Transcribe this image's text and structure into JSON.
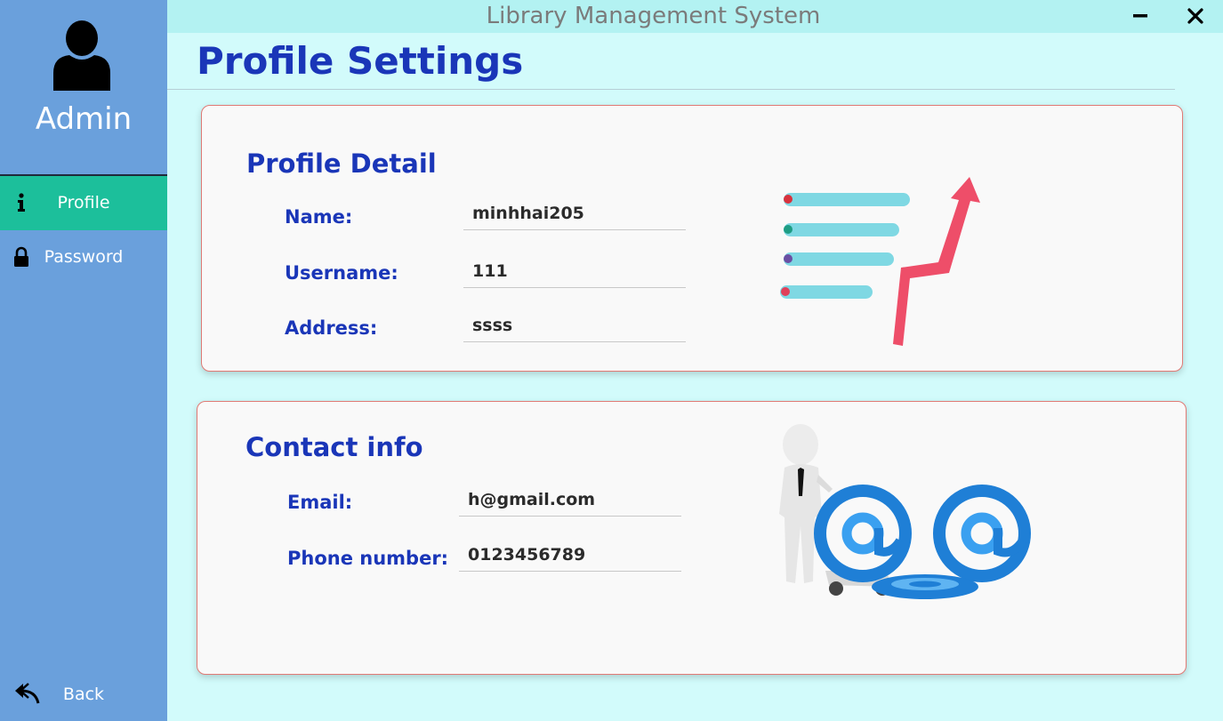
{
  "window": {
    "title": "Library Management System",
    "minimize_icon": "minimize-icon",
    "close_icon": "close-icon"
  },
  "sidebar": {
    "user_icon": "user-icon",
    "username": "Admin",
    "items": [
      {
        "label": "Profile",
        "icon": "info-icon",
        "active": true
      },
      {
        "label": "Password",
        "icon": "lock-icon",
        "active": false
      }
    ],
    "back": {
      "label": "Back",
      "icon": "reply-icon"
    }
  },
  "page": {
    "title": "Profile Settings"
  },
  "profile_detail": {
    "title": "Profile Detail",
    "fields": [
      {
        "label": "Name:",
        "value": "minhhai205"
      },
      {
        "label": "Username:",
        "value": "111"
      },
      {
        "label": "Address:",
        "value": "ssss"
      }
    ],
    "illustration": "growth-chart-illustration"
  },
  "contact_info": {
    "title": "Contact info",
    "fields": [
      {
        "label": "Email:",
        "value": "h@gmail.com"
      },
      {
        "label": "Phone number:",
        "value": "0123456789"
      }
    ],
    "illustration": "email-cart-illustration"
  },
  "colors": {
    "sidebar": "#6aa0dc",
    "active_nav": "#1cbf9b",
    "heading_blue": "#1a36b8",
    "background": "#d2fbfb",
    "titlebar": "#b3f2f2",
    "card_border": "#e07a75"
  }
}
